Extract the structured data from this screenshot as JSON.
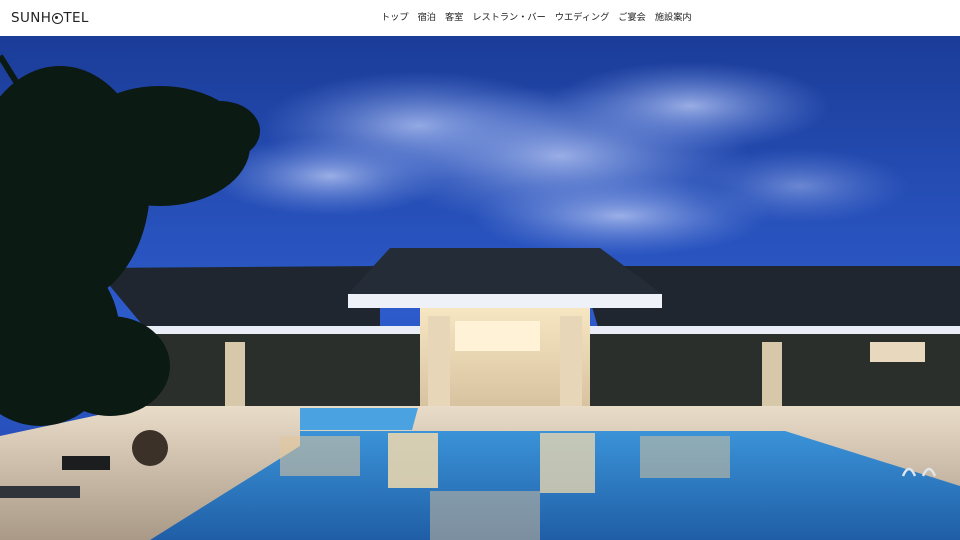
{
  "header": {
    "logo_prefix": "SUNH",
    "logo_suffix": "TEL",
    "nav": [
      {
        "label": "トップ"
      },
      {
        "label": "宿泊"
      },
      {
        "label": "客室"
      },
      {
        "label": "レストラン・バー"
      },
      {
        "label": "ウエディング"
      },
      {
        "label": "ご宴会"
      },
      {
        "label": "施設案内"
      }
    ]
  },
  "hero": {
    "image_subject": "resort-pool-twilight",
    "colors": {
      "sky_top": "#1c3f9c",
      "sky_mid": "#2f5fd0",
      "cloud": "#8fa8e8",
      "roof": "#1f2630",
      "interior_light": "#f3dcb0",
      "pool": "#2f7fc9",
      "deck": "#c9b9a6"
    }
  }
}
